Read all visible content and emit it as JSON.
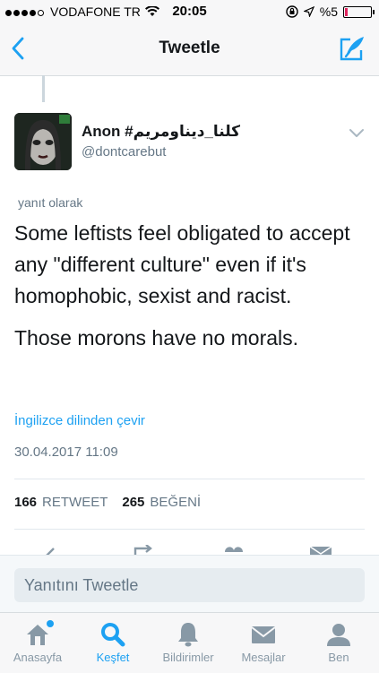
{
  "status_bar": {
    "carrier": "VODAFONE TR",
    "time": "20:05",
    "battery": "%5",
    "battery_level": 0.05
  },
  "nav": {
    "title": "Tweetle",
    "back_icon": "chevron-left-icon",
    "compose_icon": "compose-tweet-icon"
  },
  "tweet": {
    "author_name": "Anon #كلنا_ديناومريم",
    "author_handle": "@dontcarebut",
    "reply_context": "yanıt olarak",
    "text_paragraph_1": "Some leftists feel obligated to accept any \"different culture\" even if it's homophobic, sexist and racist.",
    "text_paragraph_2": "Those morons have no morals.",
    "translate_link": "İngilizce dilinden çevir",
    "timestamp": "30.04.2017 11:09",
    "retweet_count": "166",
    "retweet_label": "RETWEET",
    "like_count": "265",
    "like_label": "BEĞENİ"
  },
  "reply": {
    "placeholder": "Yanıtını Tweetle"
  },
  "tabs": [
    {
      "label": "Anasayfa",
      "icon": "home-icon",
      "active": false,
      "has_dot": true
    },
    {
      "label": "Keşfet",
      "icon": "search-icon",
      "active": true
    },
    {
      "label": "Bildirimler",
      "icon": "bell-icon",
      "active": false
    },
    {
      "label": "Mesajlar",
      "icon": "envelope-icon",
      "active": false
    },
    {
      "label": "Ben",
      "icon": "person-icon",
      "active": false
    }
  ],
  "colors": {
    "accent": "#1da1f2",
    "muted": "#657786",
    "tab_inactive": "#8899a6"
  }
}
